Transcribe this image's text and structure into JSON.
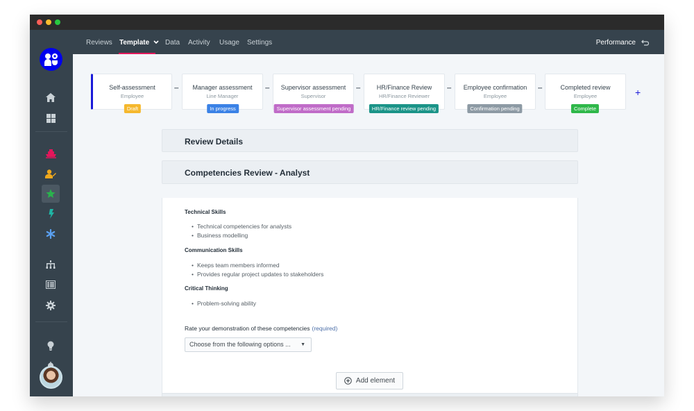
{
  "window": {
    "controls": [
      "close",
      "minimize",
      "maximize"
    ]
  },
  "sidebar": {
    "logo": "app-logo",
    "items": [
      {
        "icon": "home-icon",
        "color": "#c9d1d6"
      },
      {
        "icon": "dashboard-grid-icon",
        "color": "#c9d1d6"
      },
      {
        "icon": "ship-icon",
        "color": "#e3165b"
      },
      {
        "icon": "user-edit-icon",
        "color": "#f0a81c"
      },
      {
        "icon": "star-icon",
        "color": "#2ab24d",
        "active": true
      },
      {
        "icon": "lightning-icon",
        "color": "#1fb5a5"
      },
      {
        "icon": "asterisk-icon",
        "color": "#5aa0f0"
      },
      {
        "icon": "org-chart-icon",
        "color": "#c9d1d6"
      },
      {
        "icon": "list-panel-icon",
        "color": "#c9d1d6"
      },
      {
        "icon": "gear-icon",
        "color": "#c9d1d6"
      },
      {
        "icon": "lightbulb-icon",
        "color": "#c9d1d6"
      },
      {
        "icon": "bell-icon",
        "color": "#c9d1d6"
      }
    ]
  },
  "topnav": {
    "items": [
      {
        "label": "Reviews"
      },
      {
        "label": "Template",
        "active": true,
        "dropdown": true
      },
      {
        "label": "Data"
      },
      {
        "label": "Activity"
      },
      {
        "label": "Usage"
      },
      {
        "label": "Settings"
      }
    ],
    "right_label": "Performance",
    "right_icon": "return-icon",
    "accent": "#e3165b"
  },
  "stages": [
    {
      "title": "Self-assessment",
      "role": "Employee",
      "badge": "Draft",
      "badge_color": "#f5b82e"
    },
    {
      "title": "Manager assessment",
      "role": "Line Manager",
      "badge": "In progress",
      "badge_color": "#3b82e6"
    },
    {
      "title": "Supervisor assessment",
      "role": "Supervisor",
      "badge": "Supervisor assessment pending",
      "badge_color": "#c06cc8"
    },
    {
      "title": "HR/Finance Review",
      "role": "HR/Finance Reviewer",
      "badge": "HR/Finance review pending",
      "badge_color": "#1b9488"
    },
    {
      "title": "Employee confirmation",
      "role": "Employee",
      "badge": "Confirmation pending",
      "badge_color": "#8d9aa4"
    },
    {
      "title": "Completed review",
      "role": "Employee",
      "badge": "Complete",
      "badge_color": "#2fb84a"
    }
  ],
  "add_stage_label": "+",
  "sections": {
    "review_details": "Review Details",
    "competencies": "Competencies Review - Analyst"
  },
  "competency_groups": [
    {
      "title": "Technical Skills",
      "items": [
        "Technical competencies for analysts",
        "Business modelling"
      ]
    },
    {
      "title": "Communication Skills",
      "items": [
        "Keeps team members informed",
        "Provides regular project updates to stakeholders"
      ]
    },
    {
      "title": "Critical Thinking",
      "items": [
        "Problem-solving ability"
      ]
    }
  ],
  "rating": {
    "label": "Rate your demonstration of these competencies",
    "required": "(required)",
    "select_value": "Choose from the following options ..."
  },
  "add_element_label": "Add element"
}
